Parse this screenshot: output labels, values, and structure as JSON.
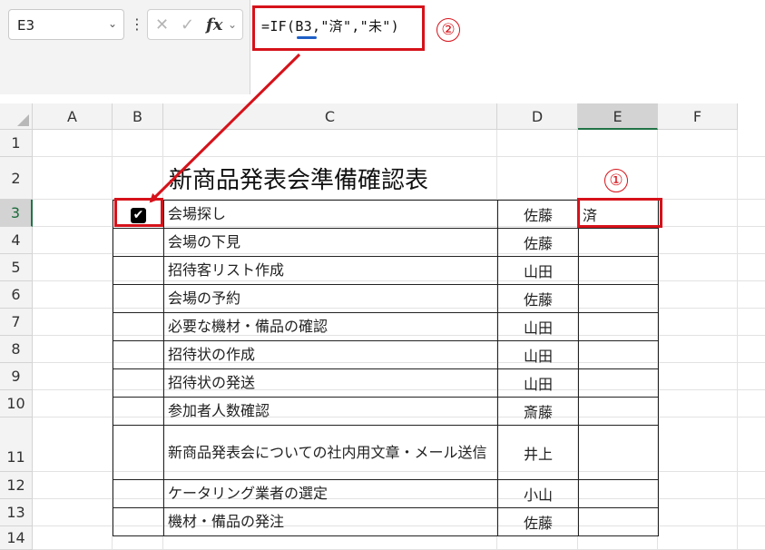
{
  "name_box": {
    "cell": "E3"
  },
  "formula_bar": {
    "formula": "=IF(B3,\"済\",\"未\")",
    "fx_label": "fx"
  },
  "annotations": {
    "marker_1": "①",
    "marker_2": "②"
  },
  "columns": [
    "A",
    "B",
    "C",
    "D",
    "E",
    "F"
  ],
  "selected_column": "E",
  "rows": [
    "1",
    "2",
    "3",
    "4",
    "5",
    "6",
    "7",
    "8",
    "9",
    "10",
    "11",
    "12",
    "13",
    "14"
  ],
  "selected_row": "3",
  "sheet": {
    "title": "新商品発表会準備確認表",
    "tasks": [
      {
        "row": "3",
        "checked": true,
        "task": "会場探し",
        "person": "佐藤",
        "status": "済"
      },
      {
        "row": "4",
        "checked": false,
        "task": "会場の下見",
        "person": "佐藤",
        "status": ""
      },
      {
        "row": "5",
        "checked": false,
        "task": "招待客リスト作成",
        "person": "山田",
        "status": ""
      },
      {
        "row": "6",
        "checked": false,
        "task": "会場の予約",
        "person": "佐藤",
        "status": ""
      },
      {
        "row": "7",
        "checked": false,
        "task": "必要な機材・備品の確認",
        "person": "山田",
        "status": ""
      },
      {
        "row": "8",
        "checked": false,
        "task": "招待状の作成",
        "person": "山田",
        "status": ""
      },
      {
        "row": "9",
        "checked": false,
        "task": "招待状の発送",
        "person": "山田",
        "status": ""
      },
      {
        "row": "10",
        "checked": false,
        "task": "参加者人数確認",
        "person": "斎藤",
        "status": ""
      },
      {
        "row": "11",
        "checked": false,
        "task": "新商品発表会についての社内用文章・メール送信",
        "person": "井上",
        "status": ""
      },
      {
        "row": "12",
        "checked": false,
        "task": "ケータリング業者の選定",
        "person": "小山",
        "status": ""
      },
      {
        "row": "13",
        "checked": false,
        "task": "機材・備品の発注",
        "person": "佐藤",
        "status": ""
      }
    ]
  },
  "colors": {
    "highlight_red": "#d6121a",
    "selection_green": "#217346",
    "reference_blue": "#1f5fc6"
  },
  "icons": {
    "cancel": "cancel-icon",
    "enter": "check-icon",
    "function": "fx-icon",
    "dropdown": "chevron-down-icon",
    "more": "kebab-icon",
    "checkbox": "checkbox-checked-icon"
  }
}
